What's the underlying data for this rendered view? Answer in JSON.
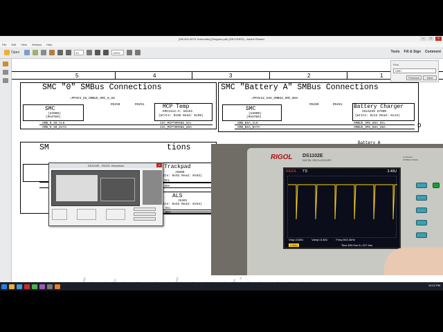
{
  "window": {
    "title": "[SM 820-3070 Schematic] (Diagram.pdf) (SECURED) - Adobe Reader",
    "controls": [
      "–",
      "□",
      "×"
    ]
  },
  "menu": [
    "File",
    "Edit",
    "View",
    "Window",
    "Help"
  ],
  "toolbar": {
    "open_label": "Open",
    "page_number": "42",
    "zoom": "100%",
    "right_labels": [
      "Tools",
      "Fill & Sign",
      "Comment"
    ]
  },
  "find": {
    "label": "Find",
    "query": "SMH",
    "prev_label": "Previous",
    "next_label": "Next"
  },
  "schematic": {
    "col_numbers": [
      "5",
      "4",
      "3",
      "2",
      "1"
    ],
    "row_letter": "D",
    "smc0": {
      "title": "SMC \"0\" SMBus Connections",
      "rail": "=PP3V3_S5_SMBUS_SMC_0_S0",
      "smc_label": "SMC",
      "smc_ref": "(U4900)",
      "smc_role": "(MASTER)",
      "r1": "R5250",
      "r2": "R5251",
      "mcp_title": "MCP Temp",
      "mcp_sub": "EMC1412-A: U5151",
      "mcp_addr": "(Write: 0x98 Read: 0x99)",
      "net1": "SMB_0_S0_CLK",
      "net2": "SMB_0_S0_DATA",
      "net3": "I2C_MCPTHMSNS_SCL",
      "net4": "I2C_MCPTHMSNS_SDA"
    },
    "smca": {
      "title": "SMC \"Battery A\" SMBus Connections",
      "rail": "=PP3V42_G3H_SMBUS_SMC_BSA",
      "smc_label": "SMC",
      "smc_ref": "(U4900)",
      "smc_role": "(MASTER)",
      "r1": "R5280",
      "r2": "R5281",
      "chg_title": "Battery Charger",
      "chg_ref": "ISL6259 U7000",
      "chg_addr": "(Write: 0x12 Read: 0x13)",
      "net1": "SMB_BSA_CLK",
      "net2": "SMB_BSA_DATA",
      "net3": "SMBUS_SMC_BSA_SCL",
      "net4": "SMBUS_SMC_BSA_SDA"
    },
    "smc_mid_title": "SM",
    "smc_mid_title_right": "tions",
    "trackpad": {
      "title": "Trackpad",
      "ref": "J5800",
      "addr": "(Write: 0x92 Read: 0x93)",
      "net1": "I2C_TPAD_SCL",
      "net2": "I2C_TPAD_SDA"
    },
    "als": {
      "title": "ALS",
      "ref": "J5401",
      "addr": "(Write: 0x52 Read: 0x53)",
      "net1": "I2C_ALS_SCL",
      "net2": "I2C_ALS_SDA"
    },
    "right_partial": "Battery A"
  },
  "watermark": "www.laptop-schematics.com",
  "dialog": {
    "title": "DS1102E - RIGOL Ultravision"
  },
  "scope": {
    "brand": "RIGOL",
    "model": "DS1102E",
    "model_sub": "DIGITAL OSCILLOSCOPE",
    "spec_top": "2 Channel",
    "spec_bottom": "100MHz 1GSa/s",
    "screen_brand": "RIGOL",
    "screen_mode": "T'D",
    "screen_trig": "3.40U",
    "vtop": "Vtop=3.60U",
    "vamp": "Vamp=3.45U",
    "freq": "Freq=943.4kHz",
    "ch1": "1.00U",
    "time": "Time 500.0ns",
    "delay": "0=-227.0ns"
  },
  "taskbar": {
    "clock": "10:12 PM"
  },
  "colors": {
    "window_bg": "#ffffff",
    "toolbar": "#e9eaec",
    "rigol_red": "#a11111",
    "trace": "#ffd21f",
    "scope_button": "#3e9fae"
  }
}
